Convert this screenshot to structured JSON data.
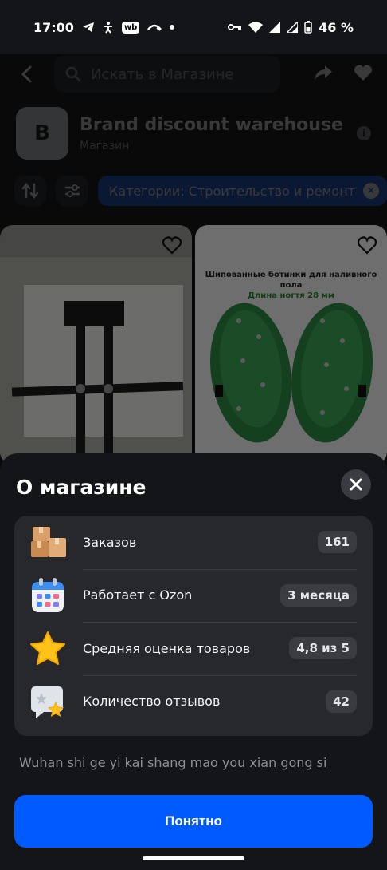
{
  "status_bar": {
    "time": "17:00",
    "wb_badge": "wb",
    "battery": "46 %"
  },
  "topbar": {
    "search_placeholder": "Искать в Магазине"
  },
  "store": {
    "logo_letter": "B",
    "name": "Brand discount warehouse",
    "type": "Магазин"
  },
  "filters": {
    "category_chip": "Категории: Строительство и ремонт"
  },
  "products": [
    {
      "caption": "",
      "caption_sub": ""
    },
    {
      "caption": "Шипованные ботинки для наливного пола",
      "caption_sub": "Длина ногтя 28 мм"
    }
  ],
  "sheet": {
    "title": "О магазине",
    "stats": [
      {
        "icon": "boxes-icon",
        "label": "Заказов",
        "value": "161"
      },
      {
        "icon": "calendar-icon",
        "label": "Работает с Ozon",
        "value": "3 месяца"
      },
      {
        "icon": "star-icon",
        "label": "Средняя оценка товаров",
        "value": "4,8 из 5"
      },
      {
        "icon": "review-icon",
        "label": "Количество отзывов",
        "value": "42"
      }
    ],
    "legal_name": "Wuhan shi ge yi kai shang mao you xian gong si",
    "ok_button": "Понятно"
  },
  "colors": {
    "accent": "#005bff",
    "chip": "#1b5fe0",
    "sheet_bg": "#141518",
    "card_bg": "#26282c"
  }
}
